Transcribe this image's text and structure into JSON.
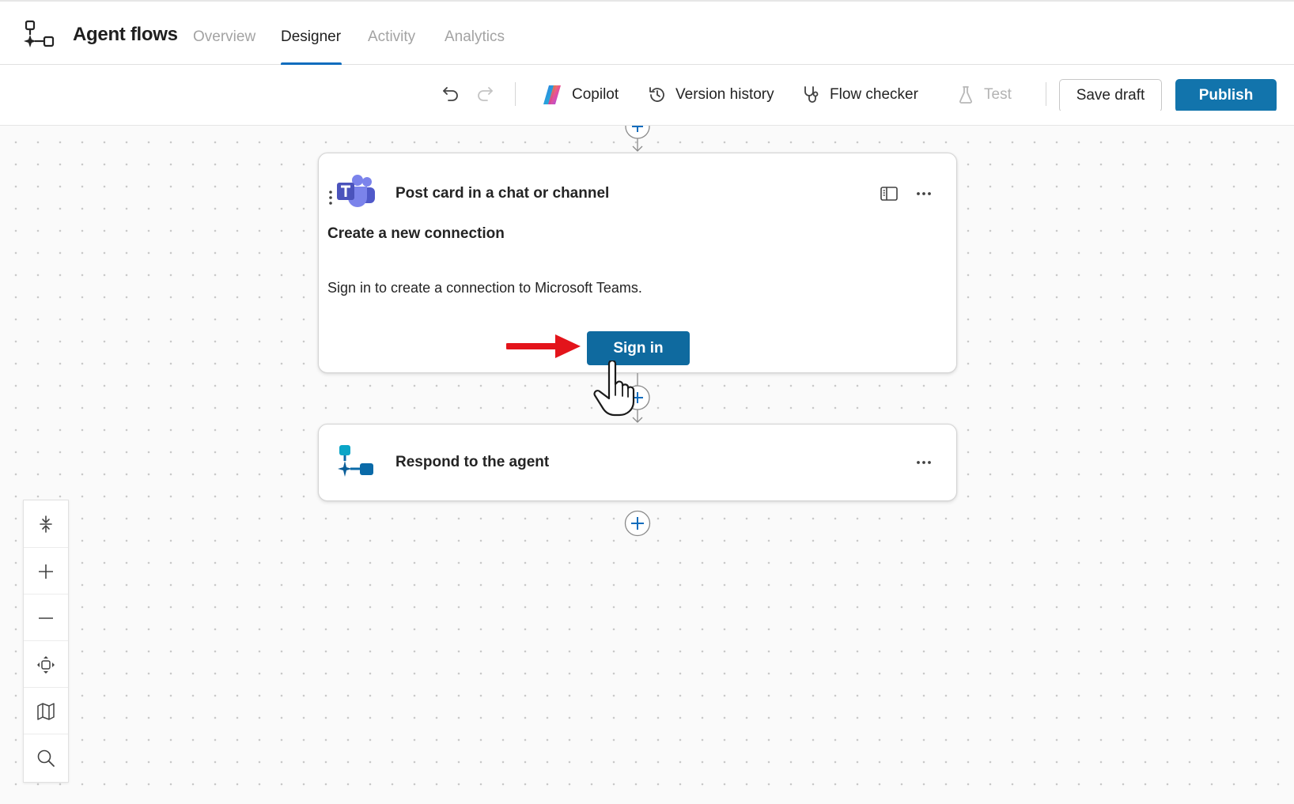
{
  "header": {
    "app_title": "Agent flows",
    "tabs": [
      {
        "label": "Overview",
        "active": false
      },
      {
        "label": "Designer",
        "active": true
      },
      {
        "label": "Activity",
        "active": false
      },
      {
        "label": "Analytics",
        "active": false
      }
    ]
  },
  "toolbar": {
    "copilot_label": "Copilot",
    "version_history_label": "Version history",
    "flow_checker_label": "Flow checker",
    "test_label": "Test",
    "save_draft_label": "Save draft",
    "publish_label": "Publish"
  },
  "canvas": {
    "card_post": {
      "title": "Post card in a chat or channel",
      "icon": "teams-icon",
      "connection_heading": "Create a new connection",
      "connection_description": "Sign in to create a connection to Microsoft Teams.",
      "sign_in_label": "Sign in"
    },
    "card_respond": {
      "title": "Respond to the agent",
      "icon": "agent-flow-icon"
    }
  },
  "zoom_controls": [
    "fit-height-icon",
    "zoom-in-icon",
    "zoom-out-icon",
    "fit-view-icon",
    "minimap-icon",
    "search-icon"
  ],
  "colors": {
    "accent": "#0f6cbd",
    "publish_bg": "#1274ac",
    "sign_in_bg": "#0f6a9f",
    "annotation_arrow": "#e3141b"
  }
}
